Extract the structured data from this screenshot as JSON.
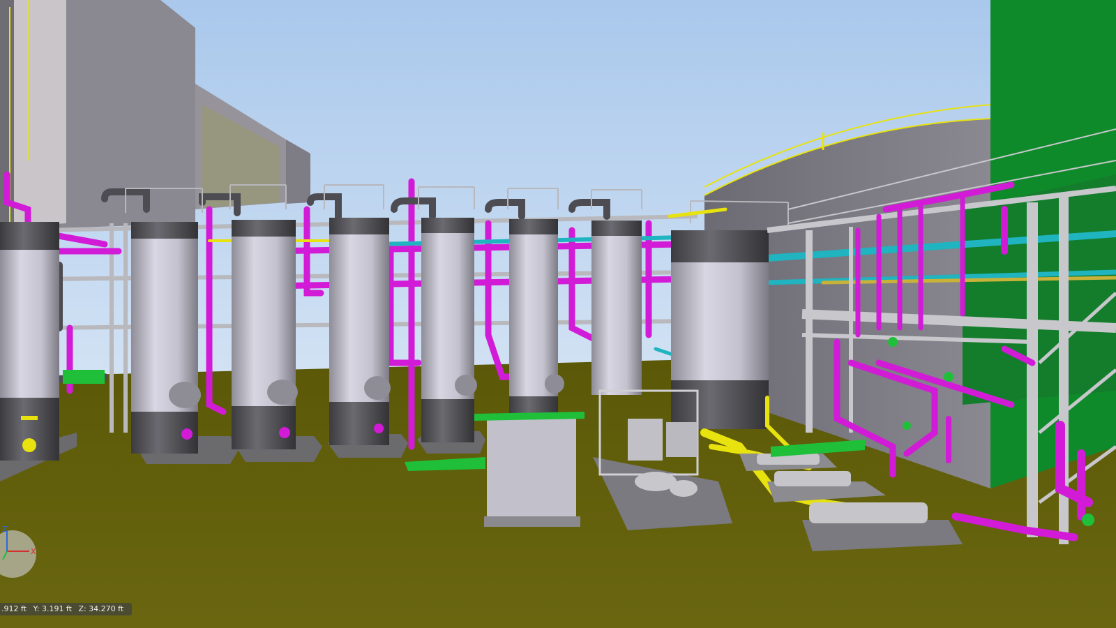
{
  "viewport": {
    "type": "3d-plant-model-view",
    "colors": {
      "sky": "#b9d3ee",
      "ground": "#5c5a0a",
      "process_pipe": "#d21bd6",
      "utility_pipe_yellow": "#e8e20e",
      "utility_pipe_cyan": "#1fb4c0",
      "vessel": "#c8c6d2",
      "vessel_band": "#555558",
      "steel": "#c7c7cc",
      "green_tank": "#0f8a2a"
    }
  },
  "axis_triad": {
    "labels": [
      "Z",
      "X"
    ],
    "icon": "xyz-axis-triad-icon"
  },
  "coordinates": {
    "x_text": ".912 ft",
    "y_text": "Y: 3.191 ft",
    "z_text": "Z: 34.270 ft"
  }
}
